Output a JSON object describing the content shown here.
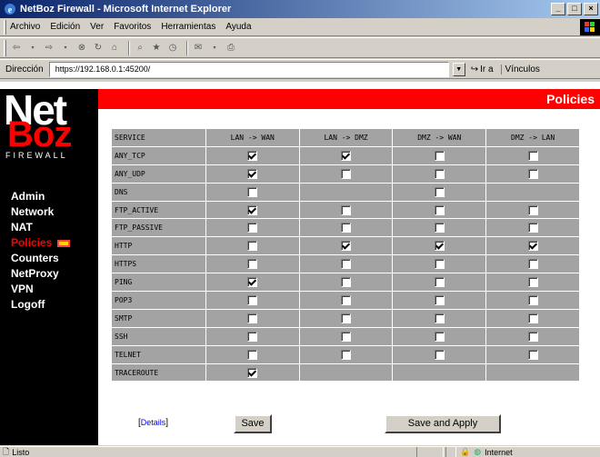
{
  "window": {
    "title": "NetBoz Firewall - Microsoft Internet Explorer",
    "controls": [
      "_",
      "□",
      "×"
    ]
  },
  "menu": [
    "Archivo",
    "Edición",
    "Ver",
    "Favoritos",
    "Herramientas",
    "Ayuda"
  ],
  "address": {
    "label": "Dirección",
    "url": "https://192.168.0.1:45200/",
    "go": "Ir a",
    "links": "Vínculos"
  },
  "page": {
    "title": "Policies",
    "logo": {
      "top": "Net",
      "bottom": "Boz",
      "tagline": "FIREWALL"
    }
  },
  "nav": {
    "items": [
      "Admin",
      "Network",
      "NAT",
      "Policies",
      "Counters",
      "NetProxy",
      "VPN",
      "Logoff"
    ],
    "active": "Policies"
  },
  "policies": {
    "columns": [
      "SERVICE",
      "LAN -> WAN",
      "LAN -> DMZ",
      "DMZ -> WAN",
      "DMZ -> LAN"
    ],
    "rows": [
      {
        "service": "ANY_TCP",
        "cells": [
          true,
          true,
          false,
          false
        ]
      },
      {
        "service": "ANY_UDP",
        "cells": [
          true,
          false,
          false,
          false
        ]
      },
      {
        "service": "DNS",
        "cells": [
          false,
          null,
          false,
          null
        ]
      },
      {
        "service": "FTP_ACTIVE",
        "cells": [
          true,
          false,
          false,
          false
        ]
      },
      {
        "service": "FTP_PASSIVE",
        "cells": [
          false,
          false,
          false,
          false
        ]
      },
      {
        "service": "HTTP",
        "cells": [
          false,
          true,
          true,
          true
        ]
      },
      {
        "service": "HTTPS",
        "cells": [
          false,
          false,
          false,
          false
        ]
      },
      {
        "service": "PING",
        "cells": [
          true,
          false,
          false,
          false
        ]
      },
      {
        "service": "POP3",
        "cells": [
          false,
          false,
          false,
          false
        ]
      },
      {
        "service": "SMTP",
        "cells": [
          false,
          false,
          false,
          false
        ]
      },
      {
        "service": "SSH",
        "cells": [
          false,
          false,
          false,
          false
        ]
      },
      {
        "service": "TELNET",
        "cells": [
          false,
          false,
          false,
          false
        ]
      },
      {
        "service": "TRACEROUTE",
        "cells": [
          true,
          null,
          null,
          null
        ]
      }
    ]
  },
  "actions": {
    "details": "Details",
    "save": "Save",
    "apply": "Save and Apply"
  },
  "status": {
    "text": "Listo",
    "zone": "Internet"
  }
}
